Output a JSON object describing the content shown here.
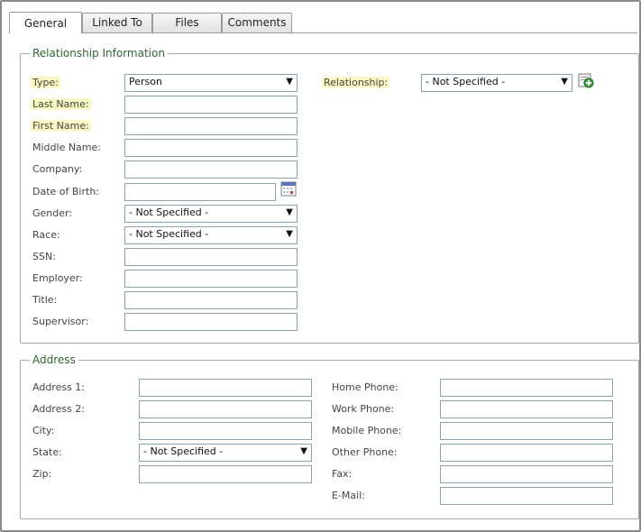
{
  "tabs": [
    "General",
    "Linked To",
    "Files",
    "Comments"
  ],
  "relationship_section": {
    "legend": "Relationship Information",
    "type_label": "Type:",
    "type_value": "Person",
    "relationship_label": "Relationship:",
    "relationship_value": "- Not Specified -",
    "last_name_label": "Last Name:",
    "first_name_label": "First Name:",
    "middle_name_label": "Middle Name:",
    "company_label": "Company:",
    "dob_label": "Date of Birth:",
    "gender_label": "Gender:",
    "gender_value": "- Not Specified -",
    "race_label": "Race:",
    "race_value": "- Not Specified -",
    "ssn_label": "SSN:",
    "employer_label": "Employer:",
    "title_label": "Title:",
    "supervisor_label": "Supervisor:"
  },
  "address_section": {
    "legend": "Address",
    "address1_label": "Address 1:",
    "address2_label": "Address 2:",
    "city_label": "City:",
    "state_label": "State:",
    "state_value": "- Not Specified -",
    "zip_label": "Zip:",
    "home_phone_label": "Home Phone:",
    "work_phone_label": "Work Phone:",
    "mobile_phone_label": "Mobile Phone:",
    "other_phone_label": "Other Phone:",
    "fax_label": "Fax:",
    "email_label": "E-Mail:"
  },
  "icons": {
    "dropdown_arrow": "▼",
    "add_relationship": "add-green-plus-icon",
    "calendar": "calendar-icon"
  },
  "colors": {
    "legend_green": "#2c6a2c",
    "required_highlight": "#fbf7c3",
    "add_icon_green": "#3aa83a"
  }
}
